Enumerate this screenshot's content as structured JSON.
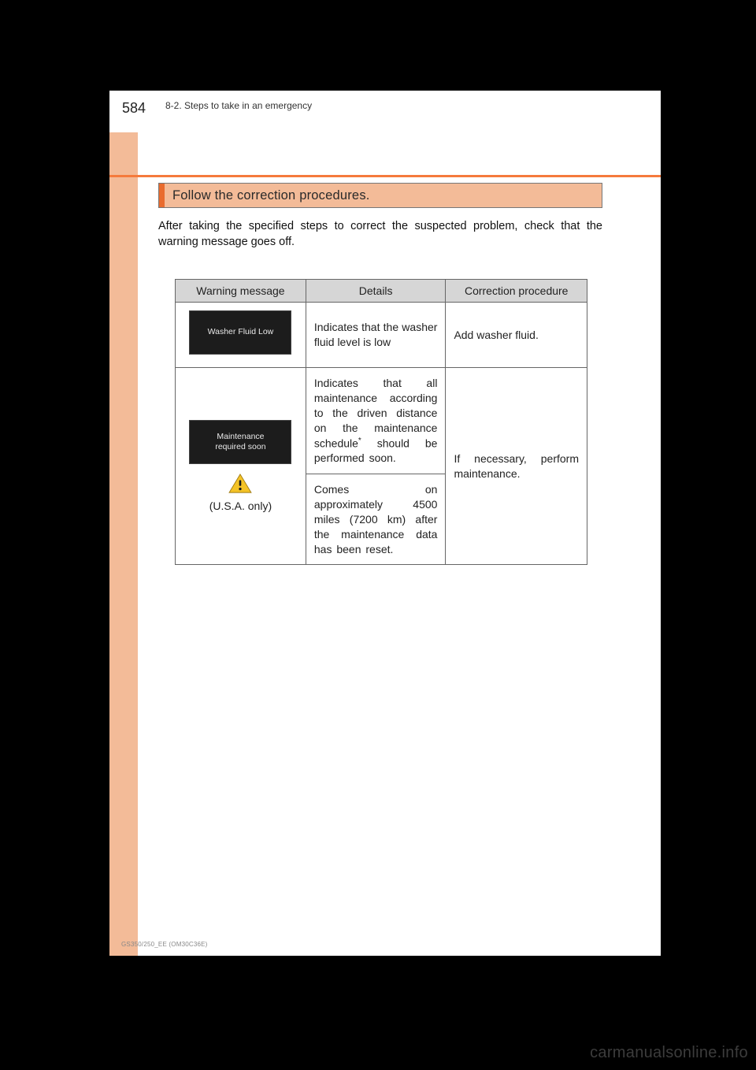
{
  "page_number": "584",
  "section_path": "8-2. Steps to take in an emergency",
  "callout_title": "Follow the correction procedures.",
  "intro": "After taking the specified steps to correct the suspected problem, check that the warning message goes off.",
  "table": {
    "headers": {
      "message": "Warning message",
      "details": "Details",
      "correction": "Correction procedure"
    },
    "rows": [
      {
        "screen_text": "Washer Fluid Low",
        "details": "Indicates that the washer fluid level is low",
        "correction": "Add washer fluid."
      },
      {
        "screen_text": "Maintenance\nrequired soon",
        "usa_only": "(U.S.A. only)",
        "details_a_prefix": "Indicates that all maintenance according to the driven distance on the maintenance schedule",
        "details_a_suffix": " should be performed soon.",
        "details_b": "Comes on approximately 4500 miles (7200 km) after the maintenance data has been reset.",
        "correction": "If necessary, perform maintenance."
      }
    ],
    "footnote_marker": "*"
  },
  "model_code": "GS350/250_EE (OM30C36E)",
  "watermark": "carmanualsonline.info"
}
